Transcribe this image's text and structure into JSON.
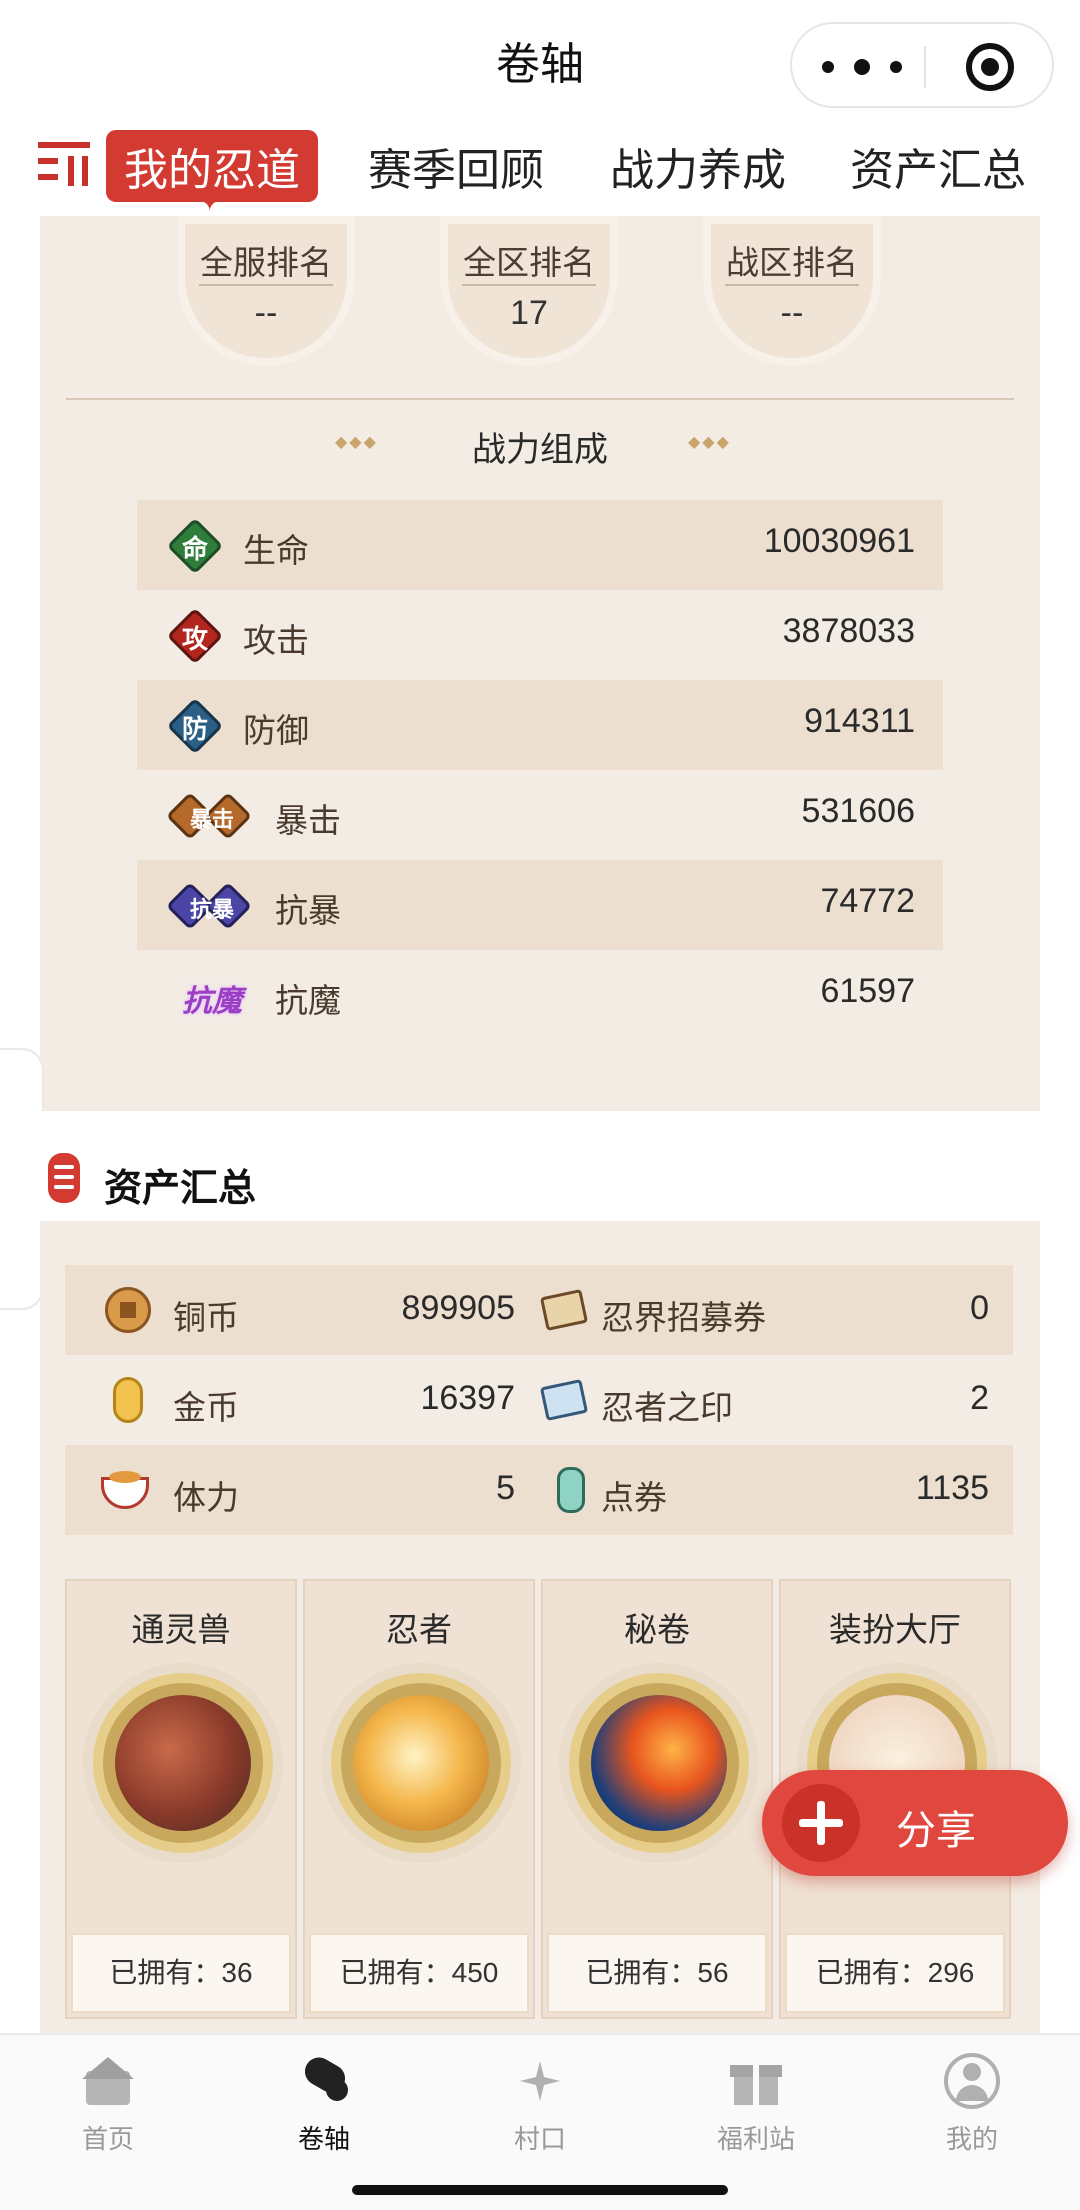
{
  "header": {
    "title": "卷轴"
  },
  "tabs": [
    {
      "label": "我的忍道",
      "active": true
    },
    {
      "label": "赛季回顾",
      "active": false
    },
    {
      "label": "战力养成",
      "active": false
    },
    {
      "label": "资产汇总",
      "active": false
    }
  ],
  "ranks": [
    {
      "label": "全服排名",
      "value": "--"
    },
    {
      "label": "全区排名",
      "value": "17"
    },
    {
      "label": "战区排名",
      "value": "--"
    }
  ],
  "combat": {
    "title": "战力组成",
    "stats": [
      {
        "icon": "命",
        "label": "生命",
        "value": "10030961",
        "color": "#2f7d3b"
      },
      {
        "icon": "攻",
        "label": "攻击",
        "value": "3878033",
        "color": "#b3261e"
      },
      {
        "icon": "防",
        "label": "防御",
        "value": "914311",
        "color": "#2b5f86"
      },
      {
        "icon": "暴击",
        "label": "暴击",
        "value": "531606",
        "color": "#b5692a"
      },
      {
        "icon": "抗暴",
        "label": "抗暴",
        "value": "74772",
        "color": "#4b46a6"
      },
      {
        "icon": "抗魔",
        "label": "抗魔",
        "value": "61597",
        "color": "#9b3fc4"
      }
    ]
  },
  "assets": {
    "title": "资产汇总",
    "items": [
      {
        "name": "铜币",
        "value": "899905",
        "icon": "copper-coin-icon"
      },
      {
        "name": "忍界招募券",
        "value": "0",
        "icon": "recruit-ticket-icon"
      },
      {
        "name": "金币",
        "value": "16397",
        "icon": "gold-coin-icon"
      },
      {
        "name": "忍者之印",
        "value": "2",
        "icon": "ninja-seal-icon"
      },
      {
        "name": "体力",
        "value": "5",
        "icon": "ramen-icon"
      },
      {
        "name": "点券",
        "value": "1135",
        "icon": "voucher-icon"
      }
    ]
  },
  "cards": [
    {
      "title": "通灵兽",
      "owned": "已拥有：36"
    },
    {
      "title": "忍者",
      "owned": "已拥有：450"
    },
    {
      "title": "秘卷",
      "owned": "已拥有：56"
    },
    {
      "title": "装扮大厅",
      "owned": "已拥有：296"
    }
  ],
  "share": {
    "label": "分享"
  },
  "nav": [
    {
      "label": "首页",
      "active": false
    },
    {
      "label": "卷轴",
      "active": true
    },
    {
      "label": "村口",
      "active": false
    },
    {
      "label": "福利站",
      "active": false
    },
    {
      "label": "我的",
      "active": false
    }
  ],
  "colors": {
    "accent": "#d33a32",
    "panel": "#f3ece4",
    "row": "#ecdfd0"
  }
}
